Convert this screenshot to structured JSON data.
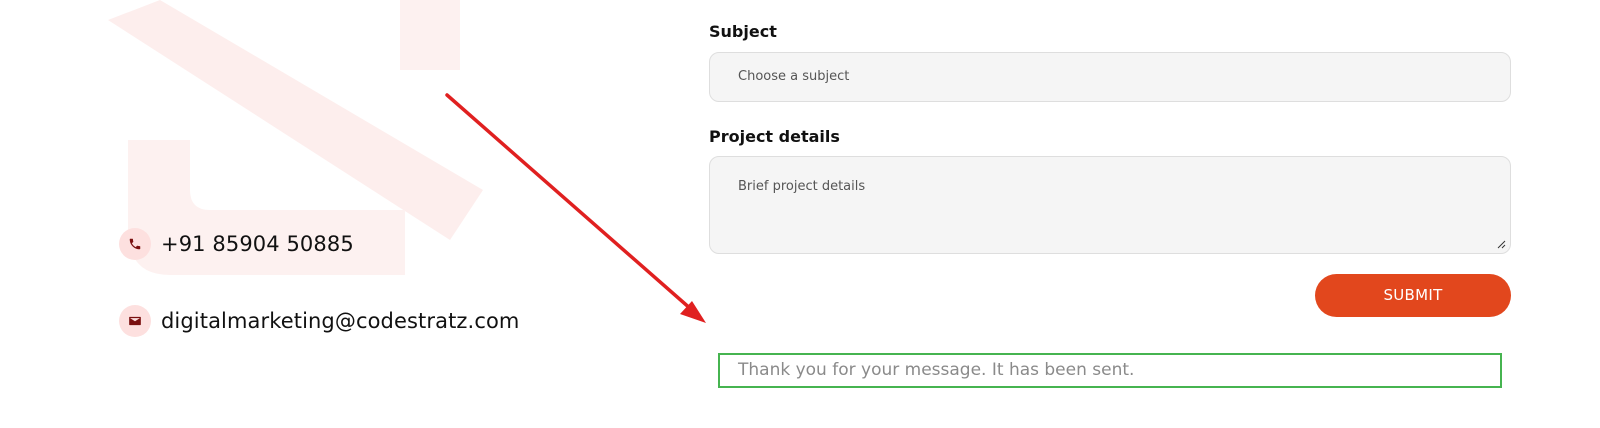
{
  "contact": {
    "phone": "+91 85904 50885",
    "email": "digitalmarketing@codestratz.com",
    "phone_icon": "phone-icon",
    "email_icon": "envelope-icon"
  },
  "form": {
    "subject": {
      "label": "Subject",
      "placeholder": "Choose a subject"
    },
    "details": {
      "label": "Project details",
      "placeholder": "Brief  project details"
    },
    "submit_label": "SUBMIT",
    "success_message": "Thank you for your message. It has been sent."
  },
  "colors": {
    "accent": "#e2471d",
    "success_border": "#46b450",
    "icon_background": "#fde0df",
    "icon_foreground": "#7a1010",
    "watermark": "#fdeeed",
    "annotation_arrow": "#e02020"
  }
}
